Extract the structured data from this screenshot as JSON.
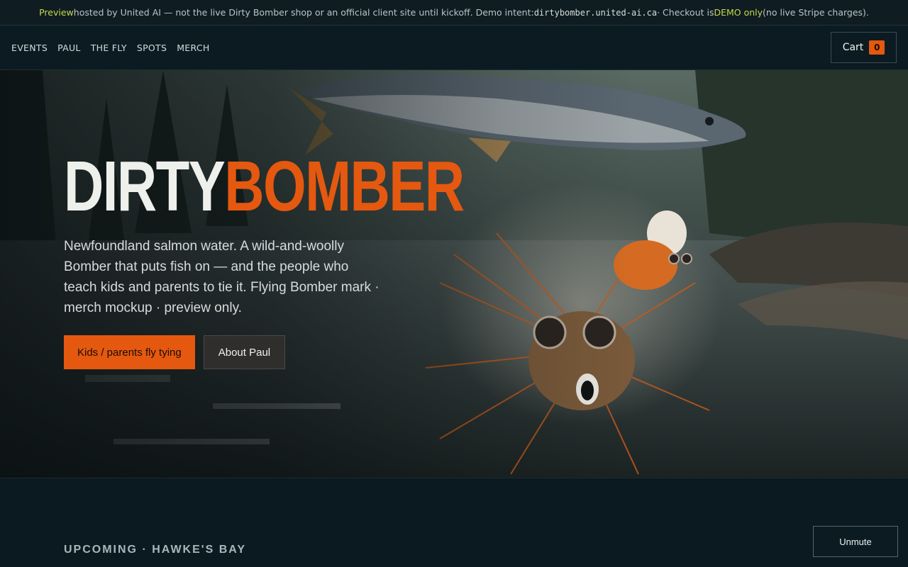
{
  "banner": {
    "preview_word": "Preview",
    "text1": " hosted by United AI — not the live Dirty Bomber shop or an official client site until kickoff. Demo intent: ",
    "domain": "dirtybomber.united-ai.ca",
    "text2": " · Checkout is ",
    "demo_only": "DEMO only",
    "text3": " (no live Stripe charges)."
  },
  "nav": {
    "items": [
      {
        "label": "EVENTS"
      },
      {
        "label": "PAUL"
      },
      {
        "label": "THE FLY"
      },
      {
        "label": "SPOTS"
      },
      {
        "label": "MERCH"
      }
    ],
    "cart_label": "Cart",
    "cart_count": "0"
  },
  "hero": {
    "logo_part1": "DIRTY",
    "logo_part2": "BOMBER",
    "tagline": "Newfoundland salmon water. A wild-and-woolly Bomber that puts fish on — and the people who teach kids and parents to tie it. Flying Bomber mark · merch mockup · preview only.",
    "primary_button": "Kids / parents fly tying",
    "secondary_button": "About Paul"
  },
  "section": {
    "title": "UPCOMING · HAWKE'S BAY"
  },
  "unmute_label": "Unmute",
  "colors": {
    "accent": "#e5580f",
    "banner_highlight": "#c5d94a",
    "background": "#0b1a21"
  }
}
